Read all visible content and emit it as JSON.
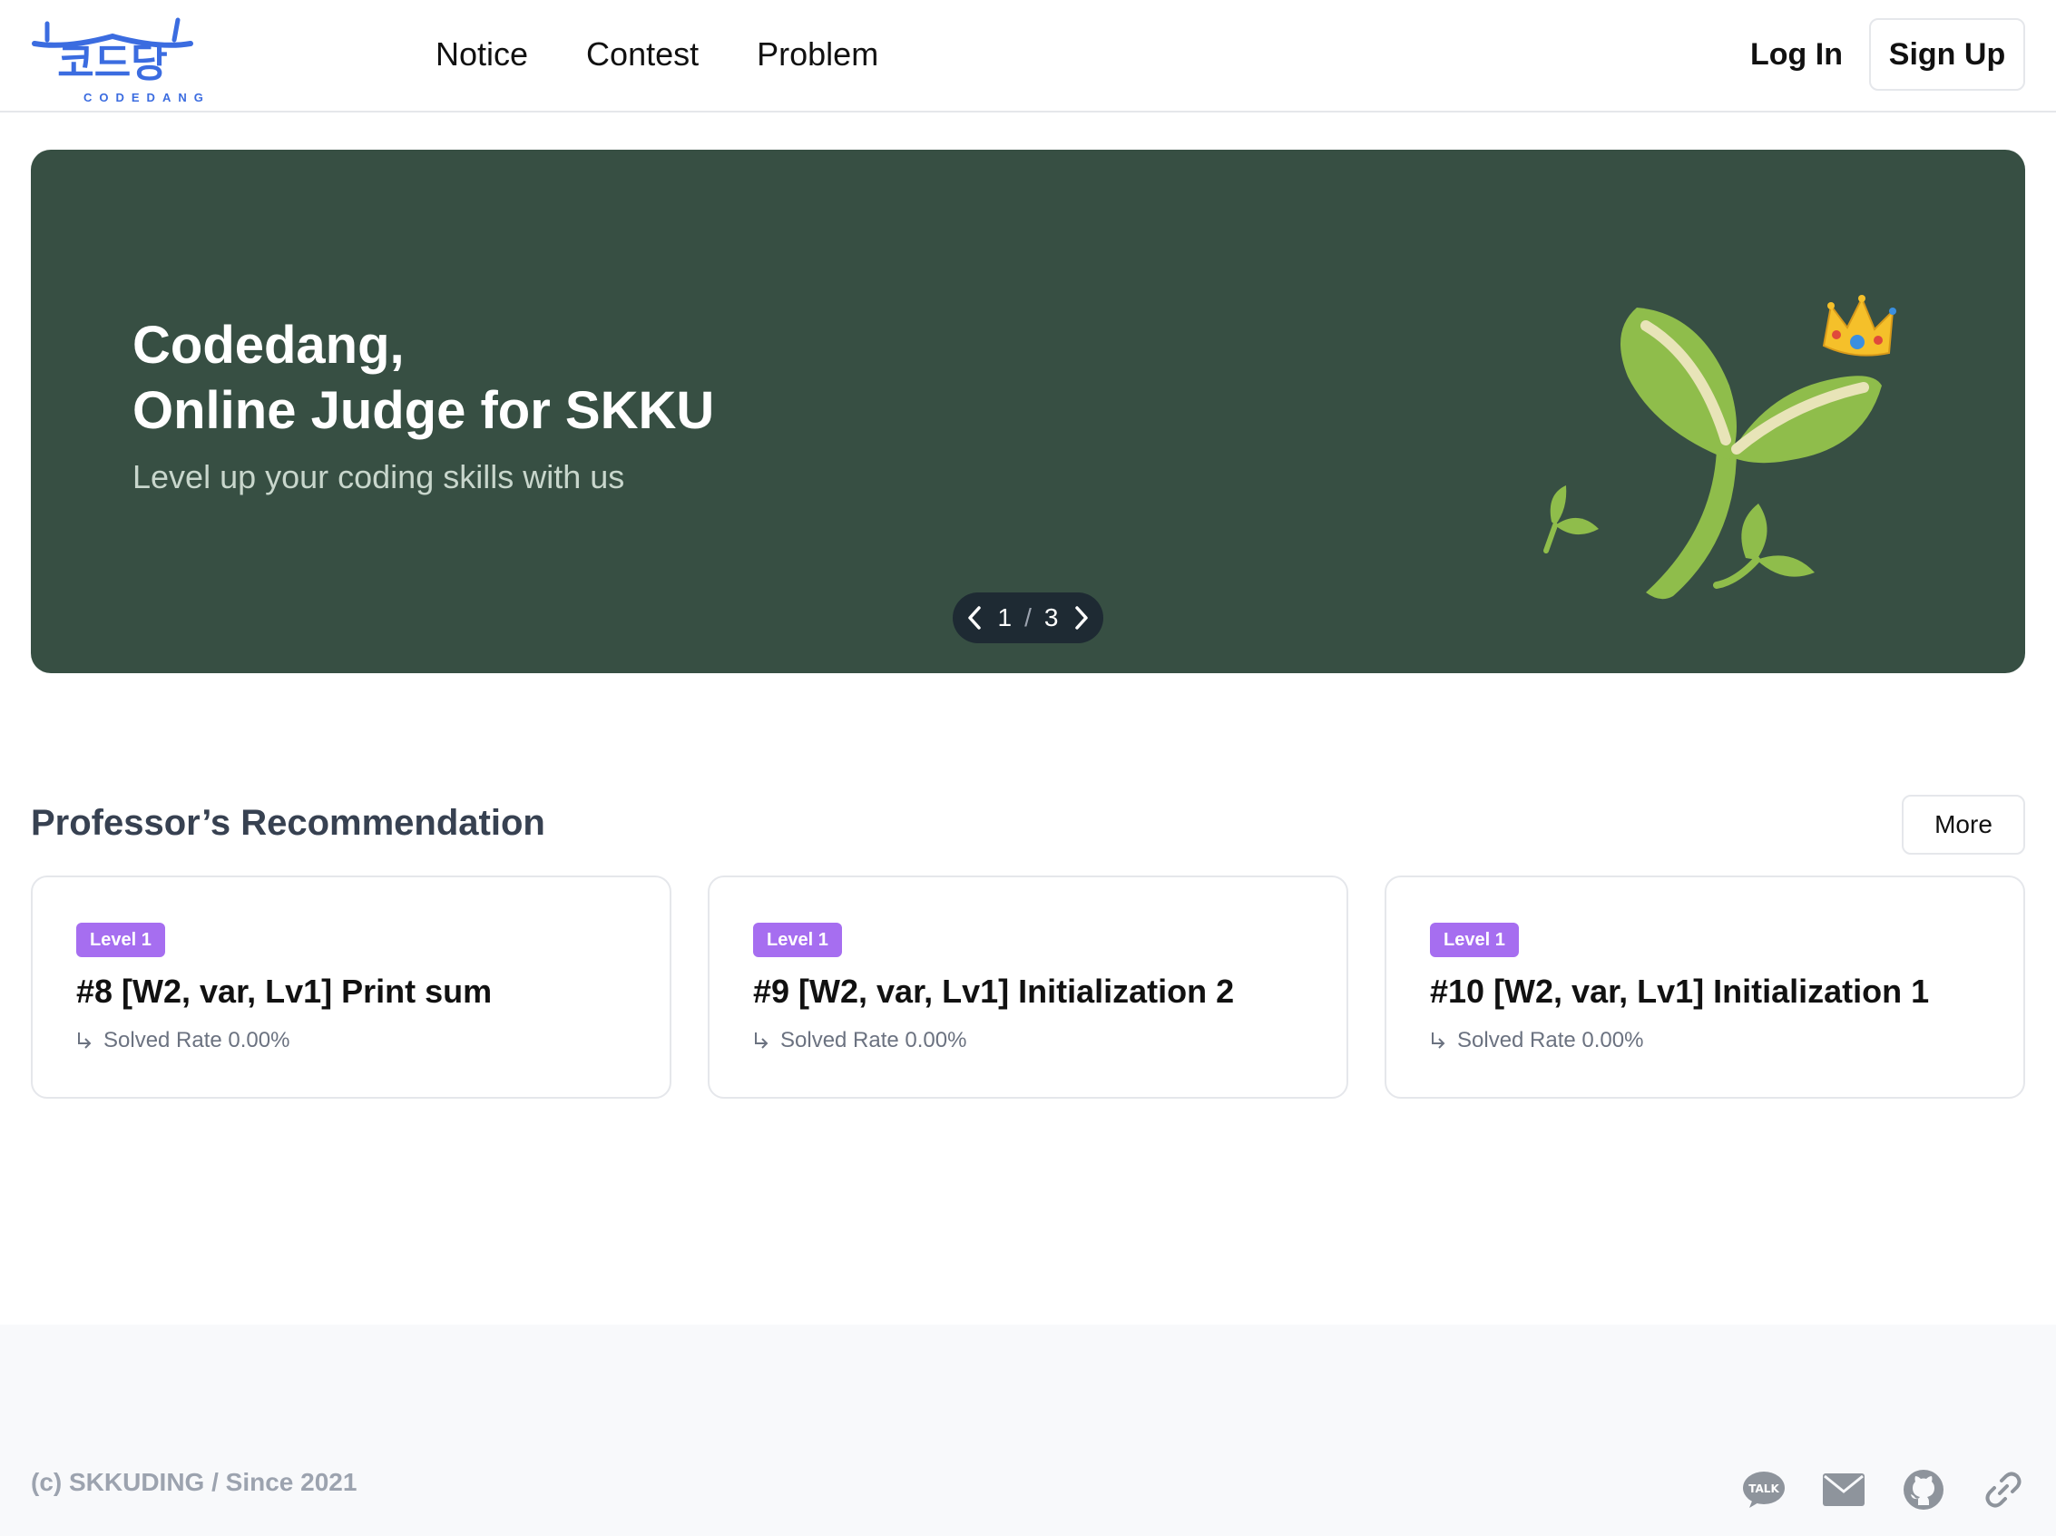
{
  "header": {
    "logo_text": "코드당",
    "logo_subtext": "CODEDANG",
    "nav": [
      "Notice",
      "Contest",
      "Problem"
    ],
    "login_label": "Log In",
    "signup_label": "Sign Up"
  },
  "hero": {
    "title_line1": "Codedang,",
    "title_line2": "Online Judge for SKKU",
    "subtitle": "Level up your coding skills with us",
    "pager_current": "1",
    "pager_separator": "/",
    "pager_total": "3",
    "bg_color": "#374f43"
  },
  "recommendation": {
    "title": "Professor’s Recommendation",
    "more_label": "More",
    "cards": [
      {
        "level": "Level 1",
        "title": "#8 [W2, var, Lv1] Print sum",
        "rate_label": "Solved Rate 0.00%"
      },
      {
        "level": "Level 1",
        "title": "#9 [W2, var, Lv1] Initialization 2",
        "rate_label": "Solved Rate 0.00%"
      },
      {
        "level": "Level 1",
        "title": "#10 [W2, var, Lv1] Initialization 1",
        "rate_label": "Solved Rate 0.00%"
      }
    ]
  },
  "footer": {
    "copyright": "(c) SKKUDING / Since 2021",
    "icons": [
      "kakaotalk-icon",
      "mail-icon",
      "github-icon",
      "link-icon"
    ],
    "talk_label": "TALK"
  },
  "colors": {
    "accent_logo": "#3b6ce0",
    "level_badge": "#a66ef0",
    "pager_bg": "#1e2a33"
  }
}
